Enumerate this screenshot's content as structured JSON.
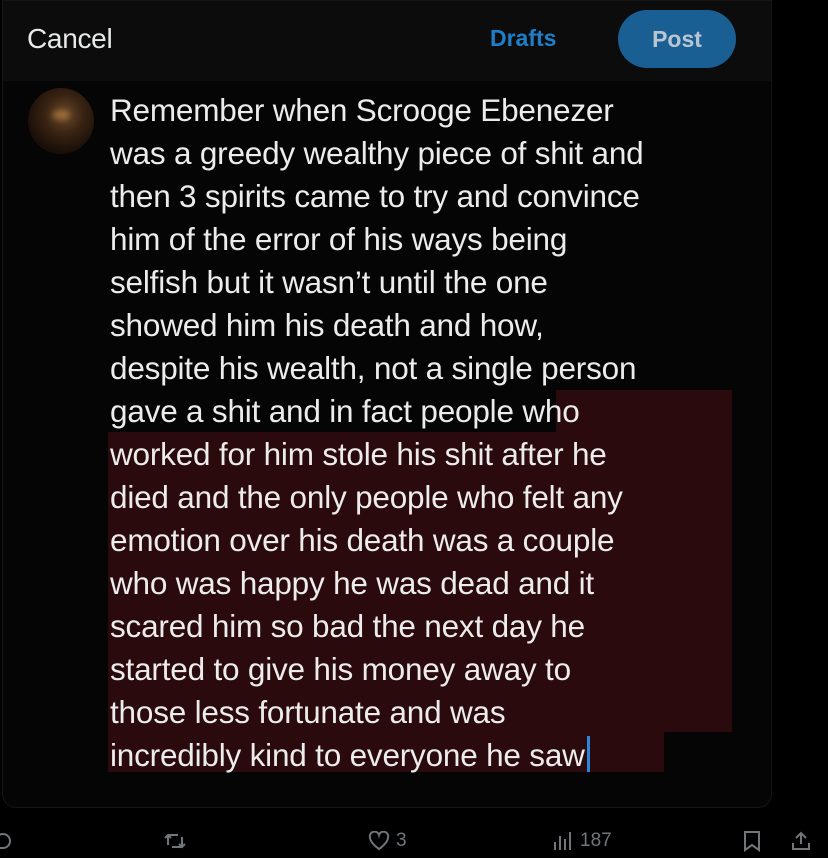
{
  "header": {
    "cancel_label": "Cancel",
    "drafts_label": "Drafts",
    "post_label": "Post"
  },
  "composer": {
    "lines": [
      "Remember when Scrooge Ebenezer",
      "was a greedy wealthy piece of shit and",
      "then 3 spirits came to try and convince",
      "him of the error of his ways being",
      "selfish but it wasn’t until the one",
      "showed him his death and how,",
      "despite his wealth, not a single person",
      "gave a shit and in fact people who",
      "worked for him stole his shit after he",
      "died and the only people who felt any",
      "emotion over his death was a couple",
      "who was happy he was dead and it",
      "scared him so bad the next day he",
      "started to give his money away to",
      "those less fortunate and was",
      "incredibly kind to everyone he saw"
    ],
    "highlight_color": "#2a0a0c",
    "caret_color": "#2a86d8"
  },
  "actions": {
    "like_count": "3",
    "views_count": "187",
    "icons": [
      "reply-icon",
      "repost-icon",
      "like-icon",
      "views-icon",
      "bookmark-icon",
      "share-icon"
    ]
  },
  "colors": {
    "accent": "#1d7fc9",
    "post_button": "#1a5f93",
    "muted": "#71767b"
  }
}
